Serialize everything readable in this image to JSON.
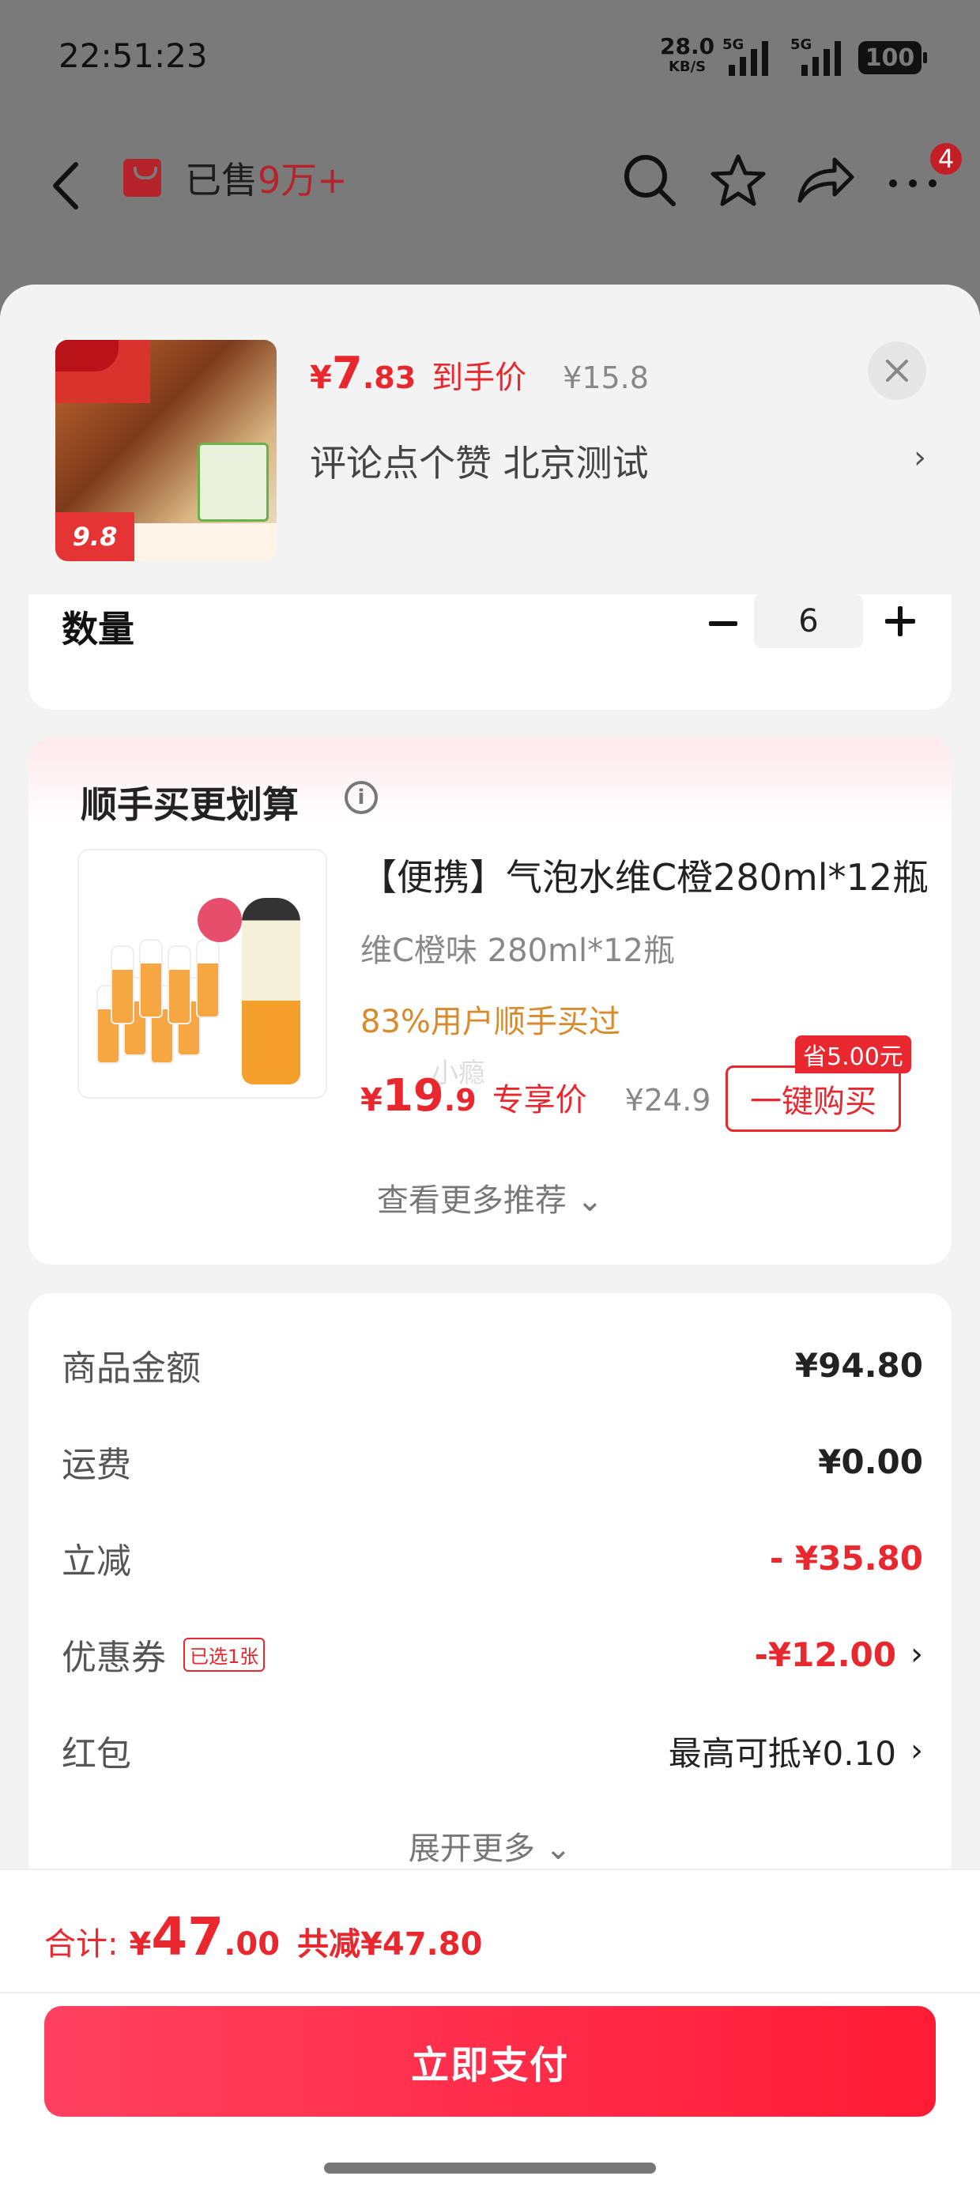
{
  "status_bar": {
    "time": "22:51:23",
    "speed_value": "28.0",
    "speed_unit": "KB/S",
    "net1": "5G",
    "net2": "5G",
    "battery": "100"
  },
  "top_nav": {
    "sold_prefix": "已售",
    "sold_count": "9万+",
    "cart_badge": "4"
  },
  "product": {
    "price_yen": "¥",
    "price_int": "7",
    "price_dec": ".83",
    "price_label": "到手价",
    "original_price": "¥15.8",
    "sku_text": "评论点个赞  北京测试",
    "thumb_price": "9.8",
    "chevron": "›"
  },
  "quantity": {
    "label": "数量",
    "value": "6"
  },
  "recommend": {
    "title": "顺手买更划算",
    "info_glyph": "i",
    "item": {
      "name": "【便携】气泡水维C橙280ml*12瓶",
      "spec": "维C橙味 280ml*12瓶",
      "stat": "83%用户顺手买过",
      "watermark": "小瘾",
      "price_yen": "¥",
      "price_int": "19",
      "price_dec": ".9",
      "price_label": "专享价",
      "original_price": "¥24.9",
      "save_tag": "省5.00元",
      "buy_label": "一键购买"
    },
    "more_label": "查看更多推荐 ⌄"
  },
  "summary": {
    "rows": [
      {
        "label": "商品金额",
        "value": "¥94.80"
      },
      {
        "label": "运费",
        "value": "¥0.00"
      },
      {
        "label": "立减",
        "value": "- ¥35.80"
      },
      {
        "label": "优惠券",
        "tag": "已选1张",
        "value": "-¥12.00",
        "arrow": "›"
      },
      {
        "label": "红包",
        "value": "最高可抵¥0.10",
        "arrow": "›"
      }
    ],
    "expand_label": "展开更多 ⌄"
  },
  "footer": {
    "total_label": "合计:",
    "total_yen": "¥",
    "total_int": "47",
    "total_dec": ".00",
    "total_saved": "共减¥47.80",
    "pay_label": "立即支付"
  },
  "colors": {
    "accent_red": "#e8272e",
    "overlay": "#7a7a7a",
    "stat_orange": "#d88a2c"
  }
}
